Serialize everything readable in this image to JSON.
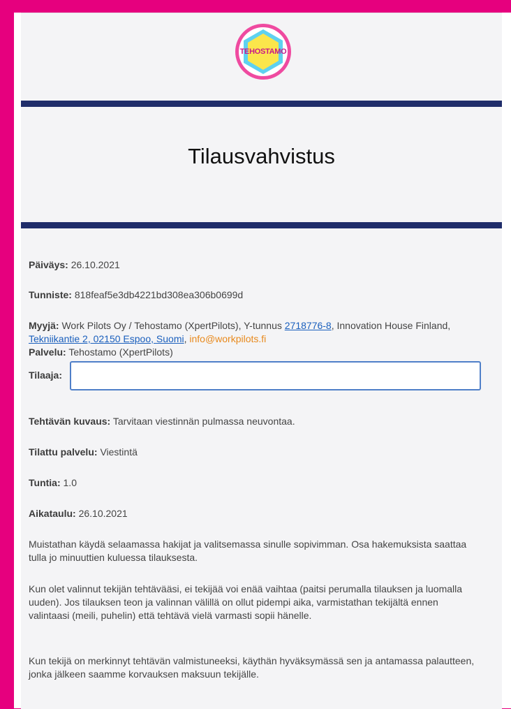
{
  "logo": {
    "text": "TEHOSTAMO",
    "ring_color": "#ef4aa0",
    "inner_color": "#5ed1f0"
  },
  "header": {
    "title": "Tilausvahvistus"
  },
  "order": {
    "date_label": "Päiväys:",
    "date_value": "26.10.2021",
    "id_label": "Tunniste:",
    "id_value": "818feaf5e3db4221bd308ea306b0699d",
    "seller_label": "Myyjä:",
    "seller_text": "Work Pilots Oy / Tehostamo (XpertPilots), Y-tunnus",
    "seller_ytunnus": "2718776-8",
    "seller_mid": ", Innovation House Finland,",
    "seller_address": "Tekniikantie 2, 02150 Espoo, Suomi",
    "seller_comma": ",",
    "seller_email": "info@workpilots.fi",
    "service_label": "Palvelu:",
    "service_value": "Tehostamo (XpertPilots)",
    "customer_label": "Tilaaja:",
    "customer_value": "",
    "task_label": "Tehtävän kuvaus:",
    "task_value": "Tarvitaan viestinnän pulmassa neuvontaa.",
    "ordered_label": "Tilattu palvelu:",
    "ordered_value": "Viestintä",
    "hours_label": "Tuntia:",
    "hours_value": "1.0",
    "schedule_label": "Aikataulu:",
    "schedule_value": "26.10.2021"
  },
  "paragraphs": {
    "p1": "Muistathan käydä selaamassa hakijat ja valitsemassa sinulle sopivimman. Osa hakemuksista saattaa tulla jo minuuttien kuluessa tilauksesta.",
    "p2": "Kun olet valinnut tekijän tehtävääsi, ei tekijää voi enää vaihtaa (paitsi perumalla tilauksen ja luomalla uuden). Jos tilauksen teon ja valinnan välillä on ollut pidempi aika, varmistathan tekijältä ennen valintaasi (meili, puhelin) että tehtävä vielä varmasti sopii hänelle.",
    "p3": "Kun tekijä on merkinnyt tehtävän valmistuneeksi, käythän hyväksymässä sen ja antamassa palautteen, jonka jälkeen saamme korvauksen maksuun tekijälle."
  },
  "colors": {
    "frame": "#e6007e",
    "rule": "#202d6a",
    "link": "#1a5fbd",
    "email": "#e8891c"
  }
}
